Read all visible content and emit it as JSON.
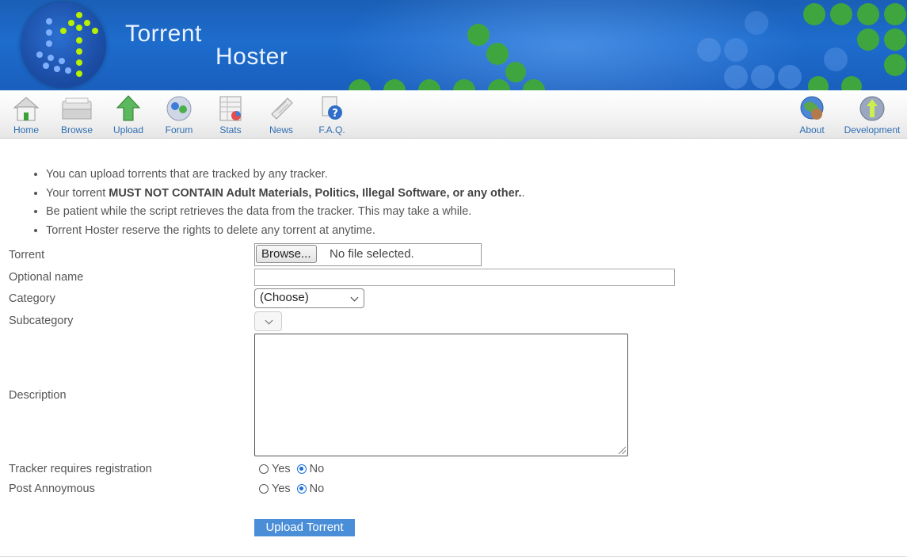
{
  "header": {
    "title_line1": "Torrent",
    "title_line2": "Hoster",
    "colors": {
      "banner": "#1d6ccd",
      "dots": "#3fa63f",
      "logo_dots": "#b7f000"
    }
  },
  "nav": {
    "left_items": [
      {
        "label": "Home",
        "icon": "home-icon"
      },
      {
        "label": "Browse",
        "icon": "browse-icon"
      },
      {
        "label": "Upload",
        "icon": "upload-icon"
      },
      {
        "label": "Forum",
        "icon": "forum-icon"
      },
      {
        "label": "Stats",
        "icon": "stats-icon"
      },
      {
        "label": "News",
        "icon": "news-icon"
      },
      {
        "label": "F.A.Q.",
        "icon": "faq-icon"
      }
    ],
    "right_items": [
      {
        "label": "About",
        "icon": "about-icon"
      },
      {
        "label": "Development",
        "icon": "development-icon"
      }
    ]
  },
  "rules": {
    "r1": "You can upload torrents that are tracked by any tracker.",
    "r2_pre": "Your torrent ",
    "r2_bold": "MUST NOT CONTAIN Adult Materials, Politics, Illegal Software, or any other.",
    "r2_post": ".",
    "r3": "Be patient while the script retrieves the data from the tracker. This may take a while.",
    "r4": "Torrent Hoster reserve the rights to delete any torrent at anytime."
  },
  "form": {
    "torrent_label": "Torrent",
    "browse_label": "Browse...",
    "file_status": "No file selected.",
    "optional_name_label": "Optional name",
    "optional_name_value": "",
    "category_label": "Category",
    "category_value": "(Choose)",
    "subcategory_label": "Subcategory",
    "subcategory_value": "",
    "description_label": "Description",
    "description_value": "",
    "tracker_reg_label": "Tracker requires registration",
    "tracker_reg_yes": "Yes",
    "tracker_reg_no": "No",
    "tracker_reg_selected": "No",
    "post_anon_label": "Post Annoymous",
    "post_anon_yes": "Yes",
    "post_anon_no": "No",
    "post_anon_selected": "No",
    "submit_label": "Upload Torrent"
  }
}
